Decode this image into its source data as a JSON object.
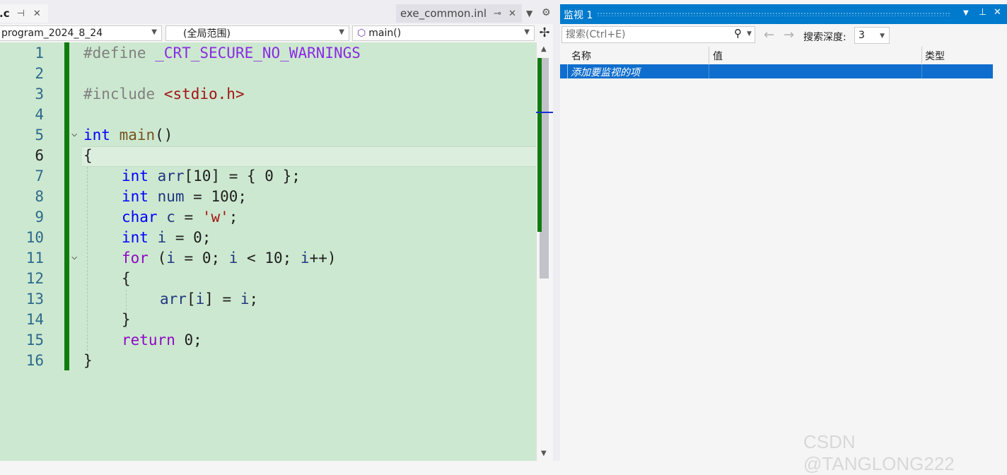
{
  "editor": {
    "tabs": [
      {
        "label": ".c",
        "pin_icon": "pin-icon",
        "close_icon": "close-icon"
      },
      {
        "label": "exe_common.inl",
        "pin_icon": "pin-icon",
        "close_icon": "close-icon"
      }
    ],
    "dropdowns": {
      "project": "program_2024_8_24",
      "scope": "(全局范围)",
      "function": "main()"
    },
    "lines": [
      "1",
      "2",
      "3",
      "4",
      "5",
      "6",
      "7",
      "8",
      "9",
      "10",
      "11",
      "12",
      "13",
      "14",
      "15",
      "16"
    ],
    "code": {
      "l1_pp": "#define",
      "l1_macro": " _CRT_SECURE_NO_WARNINGS",
      "l3_pp": "#include",
      "l3_str": " <stdio.h>",
      "l5_kw": "int",
      "l5_fn": " main",
      "l5_rest": "()",
      "l6": "{",
      "l7_kw": "int",
      "l7_var": " arr",
      "l7_rest": "[10] = { 0 };",
      "l8_kw": "int",
      "l8_var": " num",
      "l8_rest": " = 100;",
      "l9_kw": "char",
      "l9_var": " c",
      "l9_mid": " = ",
      "l9_str": "'w'",
      "l9_end": ";",
      "l10_kw": "int",
      "l10_var": " i",
      "l10_rest": " = 0;",
      "l11_ctl": "for",
      "l11_a": " (",
      "l11_v1": "i",
      "l11_b": " = 0; ",
      "l11_v2": "i",
      "l11_c": " < 10; ",
      "l11_v3": "i",
      "l11_d": "++)",
      "l12": "{",
      "l13_v1": "arr",
      "l13_a": "[",
      "l13_v2": "i",
      "l13_b": "] = ",
      "l13_v3": "i",
      "l13_c": ";",
      "l14": "}",
      "l15_ctl": "return",
      "l15_rest": " 0;",
      "l16": "}"
    }
  },
  "watch": {
    "title": "监视 1",
    "search_placeholder": "搜索(Ctrl+E)",
    "depth_label": "搜索深度:",
    "depth_value": "3",
    "columns": [
      "名称",
      "值",
      "类型"
    ],
    "add_row_text": "添加要监视的项"
  },
  "watermark": "CSDN @TANGLONG222",
  "colors": {
    "accent": "#007acc",
    "editor_bg": "#cde8d0",
    "change_bar": "#107c10",
    "selected_row": "#0f6ecd"
  }
}
